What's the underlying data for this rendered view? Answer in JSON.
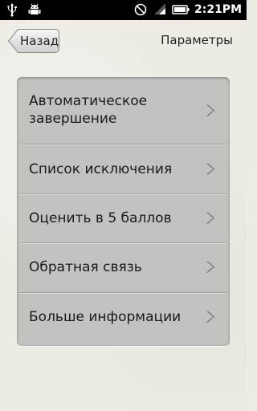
{
  "status_bar": {
    "time": "2:21PM",
    "icons": [
      "usb-icon",
      "android-debug-icon",
      "no-signal-icon",
      "wifi-icon",
      "battery-icon"
    ]
  },
  "toolbar": {
    "back_label": "Назад",
    "title": "Параметры"
  },
  "menu": {
    "items": [
      {
        "label": "Автоматическое завершение",
        "icon": "chevron-right-icon"
      },
      {
        "label": "Список исключения",
        "icon": "chevron-right-icon"
      },
      {
        "label": "Оценить в 5 баллов",
        "icon": "chevron-right-icon"
      },
      {
        "label": "Обратная связь",
        "icon": "chevron-right-icon"
      },
      {
        "label": "Больше информации",
        "icon": "chevron-right-icon"
      }
    ]
  },
  "colors": {
    "background": "#efece6",
    "panel": "#c3c2bf",
    "status_bar": "#000000"
  }
}
